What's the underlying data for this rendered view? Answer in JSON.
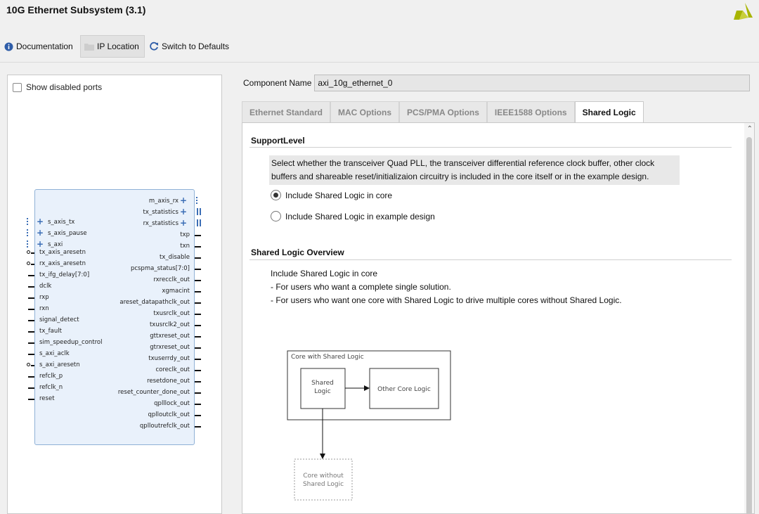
{
  "window": {
    "title": "10G Ethernet Subsystem (3.1)",
    "logo_icon": "xilinx-logo-icon"
  },
  "toolbar": {
    "documentation": "Documentation",
    "ip_location": "IP Location",
    "switch_defaults": "Switch to Defaults"
  },
  "left": {
    "show_disabled_ports": "Show disabled ports",
    "left_ports": [
      "s_axis_tx",
      "s_axis_pause",
      "s_axi",
      "tx_axis_aresetn",
      "rx_axis_aresetn",
      "tx_ifg_delay[7:0]",
      "dclk",
      "rxp",
      "rxn",
      "signal_detect",
      "tx_fault",
      "sim_speedup_control",
      "s_axi_aclk",
      "s_axi_aresetn",
      "refclk_p",
      "refclk_n",
      "reset"
    ],
    "right_ports": [
      "m_axis_rx",
      "tx_statistics",
      "rx_statistics",
      "txp",
      "txn",
      "tx_disable",
      "pcspma_status[7:0]",
      "rxrecclk_out",
      "xgmacint",
      "areset_datapathclk_out",
      "txusrclk_out",
      "txusrclk2_out",
      "gttxreset_out",
      "gtrxreset_out",
      "txuserrdy_out",
      "coreclk_out",
      "resetdone_out",
      "reset_counter_done_out",
      "qplllock_out",
      "qplloutclk_out",
      "qplloutrefclk_out"
    ]
  },
  "component": {
    "label": "Component Name",
    "value": "axi_10g_ethernet_0"
  },
  "tabs": [
    "Ethernet Standard",
    "MAC Options",
    "PCS/PMA Options",
    "IEEE1588 Options",
    "Shared Logic"
  ],
  "support": {
    "title": "SupportLevel",
    "desc_line1": "Select whether the transceiver Quad PLL, the transceiver differential reference clock buffer, other clock",
    "desc_line2": "buffers and shareable reset/initializaion circuitry is included in the core itself or in the example design.",
    "option1": "Include Shared Logic in core",
    "option2": "Include Shared Logic in example design",
    "selected": "Include Shared Logic in core"
  },
  "overview": {
    "title": "Shared Logic Overview",
    "line1": "Include Shared Logic in core",
    "line2": "- For users who want a complete single solution.",
    "line3": "- For users who want one core with Shared Logic to drive multiple cores without Shared Logic."
  },
  "diagram": {
    "outer": "Core with Shared Logic",
    "shared1": "Shared",
    "shared2": "Logic",
    "other": "Other Core Logic",
    "without1": "Core without",
    "without2": "Shared Logic"
  }
}
